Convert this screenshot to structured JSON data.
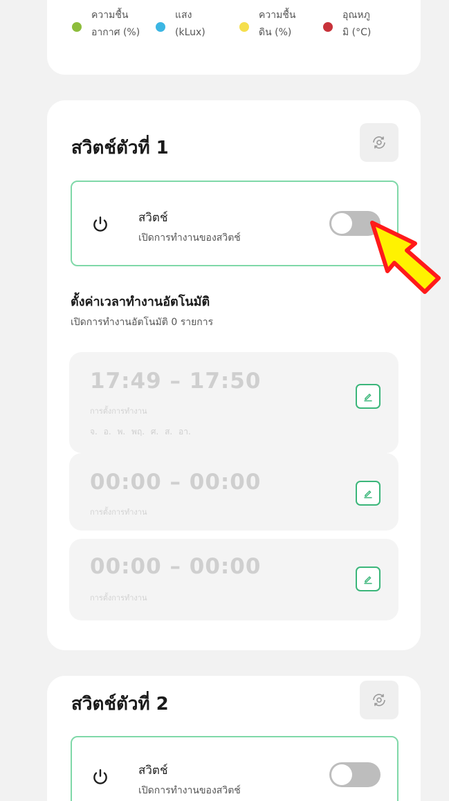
{
  "legend": [
    {
      "label_line1": "ความชื้น",
      "label_line2": "อากาศ (%)",
      "color": "#8dbd3c"
    },
    {
      "label_line1": "แสง",
      "label_line2": "(kLux)",
      "color": "#3cb6e3"
    },
    {
      "label_line1": "ความชื้น",
      "label_line2": "ดิน (%)",
      "color": "#f5df4d"
    },
    {
      "label_line1": "อุณหภู",
      "label_line2": "มิ (°C)",
      "color": "#c8323a"
    }
  ],
  "switch1": {
    "title": "สวิตช์ตัวที่ 1",
    "switch_name": "สวิตช์",
    "switch_desc": "เปิดการทำงานของสวิตช์",
    "toggle_on": false,
    "schedule_title": "ตั้งค่าเวลาทำงานอัตโนมัติ",
    "schedule_sub": "เปิดการทำงานอัตโนมัติ 0 รายการ",
    "schedules": [
      {
        "time": "17:49 – 17:50",
        "label": "การตั้งการทำงาน",
        "days": "จ. อ. พ. พฤ. ศ. ส. อา."
      },
      {
        "time": "00:00 – 00:00",
        "label": "การตั้งการทำงาน"
      },
      {
        "time": "00:00 – 00:00",
        "label": "การตั้งการทำงาน"
      }
    ]
  },
  "switch2": {
    "title": "สวิตช์ตัวที่ 2",
    "switch_name": "สวิตช์",
    "switch_desc": "เปิดการทำงานของสวิตช์",
    "toggle_on": false
  },
  "icons": {
    "settings": "settings-icon",
    "power": "power-icon",
    "edit": "pencil-icon",
    "cursor": "pointer-arrow-icon"
  },
  "colors": {
    "accent_green": "#3bb67a",
    "box_border": "#7fd8a8",
    "toggle_off": "#bdbdbd"
  }
}
